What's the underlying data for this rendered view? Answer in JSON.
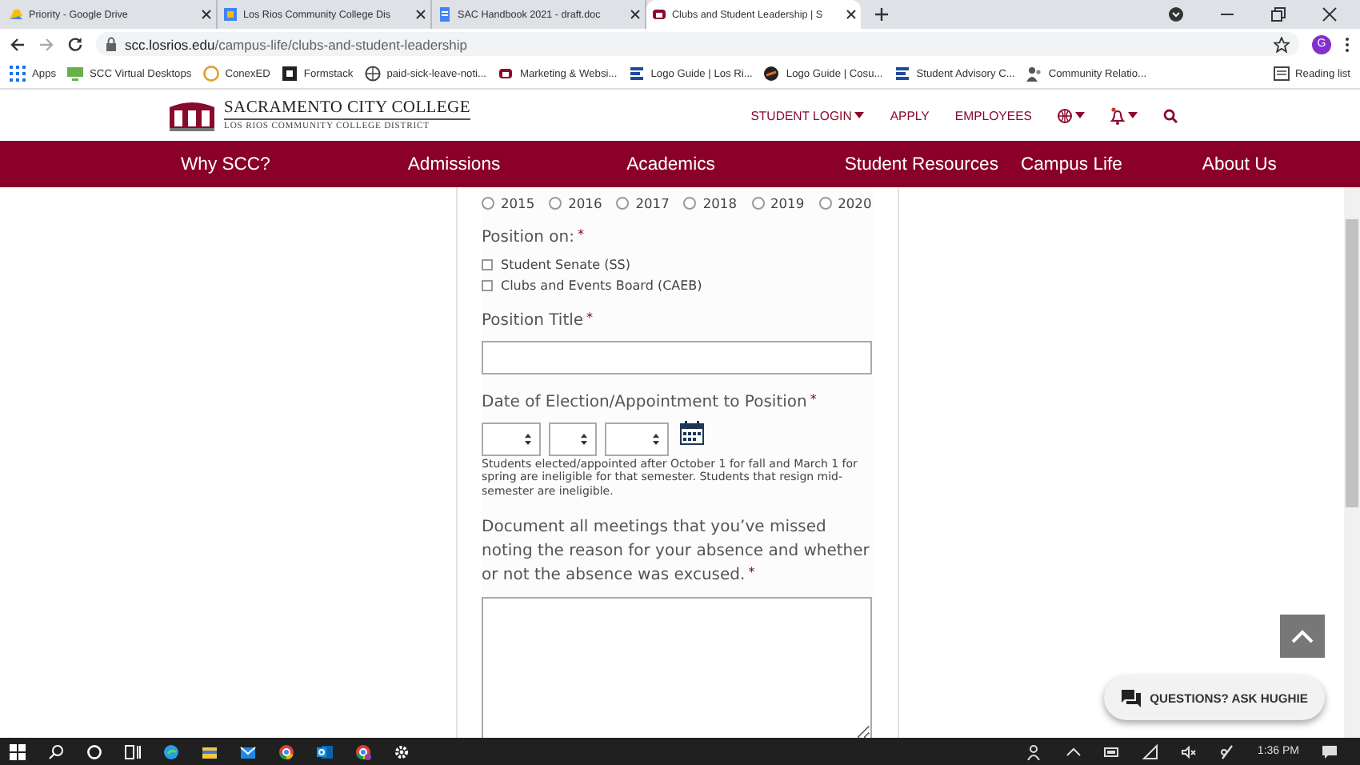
{
  "browser": {
    "tabs": [
      {
        "title": "Priority - Google Drive",
        "selected": false
      },
      {
        "title": "Los Rios Community College Dis",
        "selected": false
      },
      {
        "title": "SAC Handbook 2021 - draft.doc",
        "selected": false
      },
      {
        "title": "Clubs and Student Leadership | S",
        "selected": true
      }
    ],
    "url_host": "scc.losrios.edu",
    "url_path": "/campus-life/clubs-and-student-leadership",
    "profile": "G",
    "bookmarks": [
      "Apps",
      "SCC Virtual Desktops",
      "ConexED",
      "Formstack",
      "paid-sick-leave-noti...",
      "Marketing & Websi...",
      "Logo Guide | Los Ri...",
      "Logo Guide | Cosu...",
      "Student Advisory C...",
      "Community Relatio..."
    ],
    "reading_list": "Reading list"
  },
  "site": {
    "logo_title": "SACRAMENTO CITY COLLEGE",
    "logo_subtitle": "LOS RIOS COMMUNITY COLLEGE DISTRICT",
    "utility_links": [
      {
        "label": "STUDENT LOGIN",
        "dropdown": true
      },
      {
        "label": "APPLY",
        "dropdown": false
      },
      {
        "label": "EMPLOYEES",
        "dropdown": false
      }
    ],
    "nav": [
      "Why SCC?",
      "Admissions",
      "Academics",
      "Student Resources",
      "Campus Life",
      "About Us"
    ]
  },
  "form": {
    "years": [
      {
        "label": "2015",
        "selected": false
      },
      {
        "label": "2016",
        "selected": false
      },
      {
        "label": "2017",
        "selected": false
      },
      {
        "label": "2018",
        "selected": false
      },
      {
        "label": "2019",
        "selected": false
      },
      {
        "label": "2020",
        "selected": false
      }
    ],
    "position_on": {
      "label": "Position on:",
      "mark": "*",
      "options": [
        {
          "label": "Student Senate (SS)",
          "checked": false
        },
        {
          "label": "Clubs and Events Board (CAEB)",
          "checked": false
        }
      ]
    },
    "position_title": {
      "label": "Position Title",
      "mark": "*"
    },
    "date": {
      "label": "Date of Election/Appointment to Position",
      "mark": "*",
      "note": "Students elected/appointed after October 1 for fall and March 1 for spring are ineligible for that semester. Students that resign mid-semester are ineligible."
    },
    "meetings": {
      "label": "Document all meetings that you’ve missed noting the reason for your absence and whether or not the absence was excused.",
      "mark": "*"
    }
  },
  "chat_button": "QUESTIONS? ASK HUGHIE",
  "taskbar": {
    "time": "1:36 PM"
  }
}
